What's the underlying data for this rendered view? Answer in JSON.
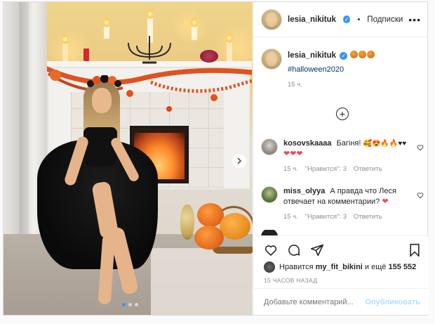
{
  "header": {
    "username": "lesia_nikituk",
    "verified_icon": "verified-badge-icon",
    "separator": "•",
    "follow_label": "Подписки",
    "more_icon": "more-options-icon"
  },
  "caption": {
    "username": "lesia_nikituk",
    "emojis": [
      "jack-o-lantern",
      "jack-o-lantern",
      "jack-o-lantern"
    ],
    "hashtag": "#halloween2020",
    "time": "15 ч."
  },
  "load_more_icon": "plus-circle-icon",
  "comments": [
    {
      "username": "kosovskaaaa",
      "text": "Багіня!",
      "emoji_tail": "🥰😍🔥🔥♥♥",
      "hearts": "❤❤❤",
      "time": "15 ч.",
      "likes": "\"Нравится\": 3",
      "reply": "Ответить"
    },
    {
      "username": "miss_olyya",
      "text": "А правда что Леся отвечает на комментарии?",
      "emoji_tail": "❤",
      "time": "15 ч.",
      "likes": "\"Нравится\": 3",
      "reply": "Ответить"
    }
  ],
  "actions": {
    "like_icon": "heart-icon",
    "comment_icon": "comment-icon",
    "share_icon": "share-icon",
    "save_icon": "bookmark-icon"
  },
  "likes": {
    "prefix": "Нравится",
    "user": "my_fit_bikini",
    "middle": "и ещё",
    "count": "155 552"
  },
  "timestamp": "15 ЧАСОВ НАЗАД",
  "comment_input": {
    "placeholder": "Добавьте комментарий...",
    "publish": "Опубликовать"
  },
  "carousel": {
    "slide_count": 3,
    "active_index": 0,
    "next_icon": "chevron-right-icon"
  },
  "colors": {
    "link": "#00376b",
    "verified": "#3897f0",
    "publish_disabled": "#b2dffc",
    "heart": "#ed4956"
  }
}
